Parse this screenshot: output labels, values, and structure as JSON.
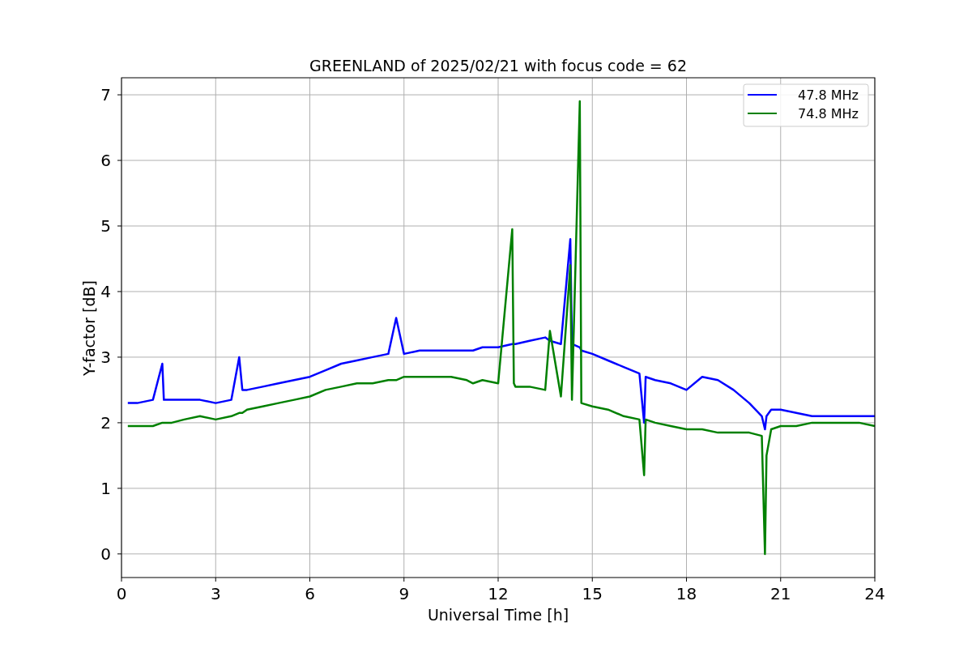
{
  "chart_data": {
    "type": "line",
    "title": "GREENLAND of 2025/02/21 with focus code = 62",
    "xlabel": "Universal Time [h]",
    "ylabel": "Y-factor [dB]",
    "xlim": [
      0,
      24
    ],
    "ylim": [
      -0.36,
      7.26
    ],
    "xticks": [
      0,
      3,
      6,
      9,
      12,
      15,
      18,
      21,
      24
    ],
    "yticks": [
      0,
      1,
      2,
      3,
      4,
      5,
      6,
      7
    ],
    "grid": true,
    "legend": true,
    "x": [
      0.2,
      0.5,
      1,
      1.3,
      1.35,
      1.6,
      2,
      2.5,
      3,
      3.5,
      3.75,
      3.85,
      4,
      4.5,
      5,
      5.5,
      6,
      6.5,
      7,
      7.5,
      8,
      8.5,
      8.75,
      9,
      9.5,
      10,
      10.5,
      11,
      11.2,
      11.5,
      12,
      12.45,
      12.5,
      12.55,
      13,
      13.5,
      13.65,
      14,
      14.3,
      14.35,
      14.6,
      14.65,
      15,
      15.5,
      16,
      16.5,
      16.65,
      16.7,
      17,
      17.5,
      18,
      18.5,
      19,
      19.5,
      20,
      20.4,
      20.5,
      20.55,
      20.7,
      21,
      21.5,
      22,
      22.5,
      23,
      23.5,
      24
    ],
    "series": [
      {
        "name": "47.8 MHz",
        "color": "#0000ff",
        "values": [
          2.3,
          2.3,
          2.35,
          2.9,
          2.35,
          2.35,
          2.35,
          2.35,
          2.3,
          2.35,
          3.0,
          2.5,
          2.5,
          2.55,
          2.6,
          2.65,
          2.7,
          2.8,
          2.9,
          2.95,
          3.0,
          3.05,
          3.6,
          3.05,
          3.1,
          3.1,
          3.1,
          3.1,
          3.1,
          3.15,
          3.15,
          3.2,
          3.2,
          3.2,
          3.25,
          3.3,
          3.25,
          3.2,
          4.8,
          3.2,
          3.15,
          3.1,
          3.05,
          2.95,
          2.85,
          2.75,
          2.0,
          2.7,
          2.65,
          2.6,
          2.5,
          2.7,
          2.65,
          2.5,
          2.3,
          2.1,
          1.9,
          2.1,
          2.2,
          2.2,
          2.15,
          2.1,
          2.1,
          2.1,
          2.1,
          2.1
        ]
      },
      {
        "name": "74.8 MHz",
        "color": "#008000",
        "values": [
          1.95,
          1.95,
          1.95,
          2.0,
          2.0,
          2.0,
          2.05,
          2.1,
          2.05,
          2.1,
          2.15,
          2.15,
          2.2,
          2.25,
          2.3,
          2.35,
          2.4,
          2.5,
          2.55,
          2.6,
          2.6,
          2.65,
          2.65,
          2.7,
          2.7,
          2.7,
          2.7,
          2.65,
          2.6,
          2.65,
          2.6,
          4.95,
          2.6,
          2.55,
          2.55,
          2.5,
          3.4,
          2.4,
          4.4,
          2.35,
          6.9,
          2.3,
          2.25,
          2.2,
          2.1,
          2.05,
          1.2,
          2.05,
          2.0,
          1.95,
          1.9,
          1.9,
          1.85,
          1.85,
          1.85,
          1.8,
          0.0,
          1.5,
          1.9,
          1.95,
          1.95,
          2.0,
          2.0,
          2.0,
          2.0,
          1.95
        ]
      }
    ]
  }
}
